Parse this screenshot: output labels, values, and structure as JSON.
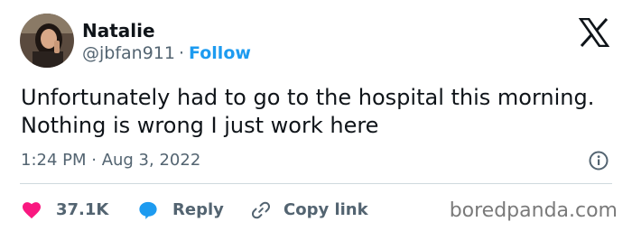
{
  "author": {
    "name": "Natalie",
    "handle": "@jbfan911",
    "separator": "·",
    "follow_label": "Follow"
  },
  "tweet": {
    "text": "Unfortunately had to go to the hospital this morning. Nothing is wrong I just work here",
    "timestamp": "1:24 PM · Aug 3, 2022"
  },
  "actions": {
    "like_count": "37.1K",
    "reply_label": "Reply",
    "copy_link_label": "Copy link"
  },
  "watermark": "boredpanda.com",
  "colors": {
    "like": "#f91880",
    "reply": "#1d9bf0",
    "follow": "#1d9bf0",
    "text": "#0f1419",
    "muted": "#536471"
  },
  "icons": {
    "like": "heart-icon",
    "reply": "speech-bubble-icon",
    "copy_link": "link-icon",
    "info": "info-icon",
    "brand": "x-logo-icon"
  }
}
